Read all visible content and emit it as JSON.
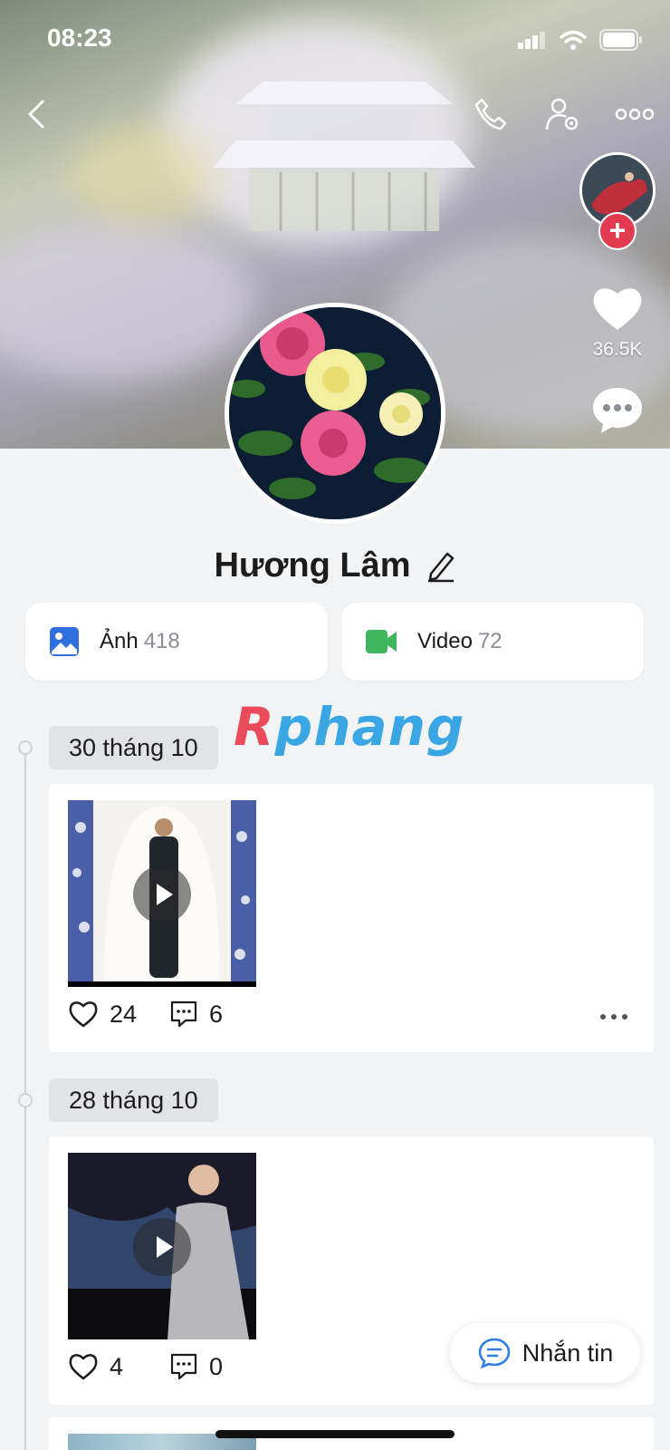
{
  "status_bar": {
    "time": "08:23"
  },
  "profile": {
    "name": "Hương Lâm",
    "likes": "36.5K"
  },
  "media": {
    "photos": {
      "label": "Ảnh",
      "count": "418"
    },
    "videos": {
      "label": "Video",
      "count": "72"
    }
  },
  "watermark": {
    "first": "R",
    "rest": "phang"
  },
  "posts": [
    {
      "date": "30 tháng 10",
      "likes": "24",
      "comments": "6"
    },
    {
      "date": "28 tháng 10",
      "likes": "4",
      "comments": "0"
    }
  ],
  "fab": {
    "label": "Nhắn tin"
  },
  "colors": {
    "accent_red": "#e23a4e",
    "photo_icon": "#2f6fe0",
    "video_icon": "#3fb55e",
    "chat_blue": "#2f7fe6"
  },
  "icons": [
    "back-icon",
    "phone-icon",
    "user-settings-icon",
    "more-icon",
    "heart-icon",
    "chat-bubble-icon",
    "edit-icon",
    "image-icon",
    "video-camera-icon",
    "comment-icon",
    "play-icon",
    "message-icon"
  ]
}
